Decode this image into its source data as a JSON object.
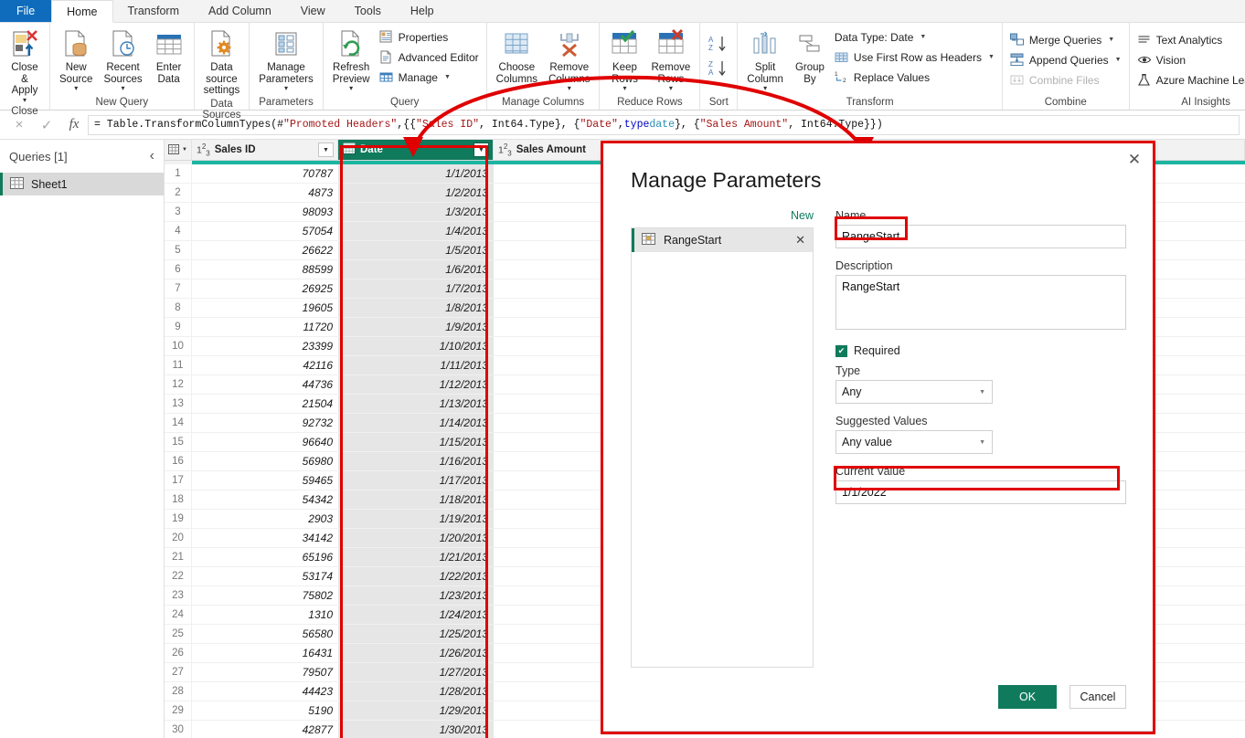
{
  "ribbon": {
    "tabs": [
      {
        "label": "File",
        "kind": "file"
      },
      {
        "label": "Home",
        "kind": "active"
      },
      {
        "label": "Transform",
        "kind": "normal"
      },
      {
        "label": "Add Column",
        "kind": "normal"
      },
      {
        "label": "View",
        "kind": "normal"
      },
      {
        "label": "Tools",
        "kind": "normal"
      },
      {
        "label": "Help",
        "kind": "normal"
      }
    ],
    "groups": {
      "close": {
        "title": "Close",
        "close_apply": "Close &\nApply"
      },
      "new_query": {
        "title": "New Query",
        "new_source": "New\nSource",
        "recent_sources": "Recent\nSources",
        "enter_data": "Enter\nData"
      },
      "data_src": {
        "title": "Data Sources",
        "data_source_settings": "Data source\nsettings"
      },
      "parameters": {
        "title": "Parameters",
        "manage_parameters": "Manage\nParameters"
      },
      "query": {
        "title": "Query",
        "refresh_preview": "Refresh\nPreview",
        "properties": "Properties",
        "advanced_editor": "Advanced Editor",
        "manage": "Manage"
      },
      "manage_cols": {
        "title": "Manage Columns",
        "choose_columns": "Choose\nColumns",
        "remove_columns": "Remove\nColumns"
      },
      "reduce_rows": {
        "title": "Reduce Rows",
        "keep_rows": "Keep\nRows",
        "remove_rows": "Remove\nRows"
      },
      "sort": {
        "title": "Sort",
        "asc": "A-Z ascending",
        "desc": "Z-A descending"
      },
      "transform": {
        "title": "Transform",
        "split_column": "Split\nColumn",
        "group_by": "Group\nBy",
        "data_type": "Data Type: Date",
        "use_first_row": "Use First Row as Headers",
        "replace_values": "Replace Values"
      },
      "combine": {
        "title": "Combine",
        "merge_queries": "Merge Queries",
        "append_queries": "Append Queries",
        "combine_files": "Combine Files"
      },
      "ai": {
        "title": "AI Insights",
        "text_analytics": "Text Analytics",
        "vision": "Vision",
        "azure_ml": "Azure Machine Learning"
      }
    }
  },
  "formula_bar": {
    "cancel_icon": "×",
    "accept_icon": "✓",
    "fx_label": "fx",
    "formula_plain": "= Table.TransformColumnTypes(#\"Promoted Headers\",{{\"Sales ID\", Int64.Type}, {\"Date\", type date}, {\"Sales Amount\", Int64.Type}})",
    "tokens": [
      {
        "t": "= Table.TransformColumnTypes(#",
        "c": "plain"
      },
      {
        "t": "\"Promoted Headers\"",
        "c": "str"
      },
      {
        "t": ",{{",
        "c": "plain"
      },
      {
        "t": "\"Sales ID\"",
        "c": "str"
      },
      {
        "t": ", Int64.Type}, {",
        "c": "plain"
      },
      {
        "t": "\"Date\"",
        "c": "str"
      },
      {
        "t": ", ",
        "c": "plain"
      },
      {
        "t": "type",
        "c": "kw"
      },
      {
        "t": " ",
        "c": "plain"
      },
      {
        "t": "date",
        "c": "ty"
      },
      {
        "t": "}, {",
        "c": "plain"
      },
      {
        "t": "\"Sales Amount\"",
        "c": "str"
      },
      {
        "t": ", Int64.Type}})",
        "c": "plain"
      }
    ]
  },
  "queries_pane": {
    "title": "Queries [1]",
    "collapse_icon": "‹",
    "items": [
      {
        "label": "Sheet1",
        "icon": "table-icon"
      }
    ]
  },
  "grid": {
    "columns": [
      {
        "name": "Sales ID",
        "type_icon": "123",
        "selected": false,
        "width": 160
      },
      {
        "name": "Date",
        "type_icon": "calendar",
        "selected": true,
        "width": 170
      },
      {
        "name": "Sales Amount",
        "type_icon": "123",
        "selected": false,
        "width": 130
      }
    ],
    "rows": [
      {
        "n": "1",
        "sales_id": "70787",
        "date": "1/1/2013",
        "amount": ""
      },
      {
        "n": "2",
        "sales_id": "4873",
        "date": "1/2/2013",
        "amount": ""
      },
      {
        "n": "3",
        "sales_id": "98093",
        "date": "1/3/2013",
        "amount": ""
      },
      {
        "n": "4",
        "sales_id": "57054",
        "date": "1/4/2013",
        "amount": ""
      },
      {
        "n": "5",
        "sales_id": "26622",
        "date": "1/5/2013",
        "amount": ""
      },
      {
        "n": "6",
        "sales_id": "88599",
        "date": "1/6/2013",
        "amount": ""
      },
      {
        "n": "7",
        "sales_id": "26925",
        "date": "1/7/2013",
        "amount": ""
      },
      {
        "n": "8",
        "sales_id": "19605",
        "date": "1/8/2013",
        "amount": ""
      },
      {
        "n": "9",
        "sales_id": "11720",
        "date": "1/9/2013",
        "amount": ""
      },
      {
        "n": "10",
        "sales_id": "23399",
        "date": "1/10/2013",
        "amount": ""
      },
      {
        "n": "11",
        "sales_id": "42116",
        "date": "1/11/2013",
        "amount": ""
      },
      {
        "n": "12",
        "sales_id": "44736",
        "date": "1/12/2013",
        "amount": ""
      },
      {
        "n": "13",
        "sales_id": "21504",
        "date": "1/13/2013",
        "amount": ""
      },
      {
        "n": "14",
        "sales_id": "92732",
        "date": "1/14/2013",
        "amount": ""
      },
      {
        "n": "15",
        "sales_id": "96640",
        "date": "1/15/2013",
        "amount": ""
      },
      {
        "n": "16",
        "sales_id": "56980",
        "date": "1/16/2013",
        "amount": ""
      },
      {
        "n": "17",
        "sales_id": "59465",
        "date": "1/17/2013",
        "amount": ""
      },
      {
        "n": "18",
        "sales_id": "54342",
        "date": "1/18/2013",
        "amount": ""
      },
      {
        "n": "19",
        "sales_id": "2903",
        "date": "1/19/2013",
        "amount": ""
      },
      {
        "n": "20",
        "sales_id": "34142",
        "date": "1/20/2013",
        "amount": ""
      },
      {
        "n": "21",
        "sales_id": "65196",
        "date": "1/21/2013",
        "amount": ""
      },
      {
        "n": "22",
        "sales_id": "53174",
        "date": "1/22/2013",
        "amount": ""
      },
      {
        "n": "23",
        "sales_id": "75802",
        "date": "1/23/2013",
        "amount": ""
      },
      {
        "n": "24",
        "sales_id": "1310",
        "date": "1/24/2013",
        "amount": ""
      },
      {
        "n": "25",
        "sales_id": "56580",
        "date": "1/25/2013",
        "amount": ""
      },
      {
        "n": "26",
        "sales_id": "16431",
        "date": "1/26/2013",
        "amount": ""
      },
      {
        "n": "27",
        "sales_id": "79507",
        "date": "1/27/2013",
        "amount": ""
      },
      {
        "n": "28",
        "sales_id": "44423",
        "date": "1/28/2013",
        "amount": ""
      },
      {
        "n": "29",
        "sales_id": "5190",
        "date": "1/29/2013",
        "amount": ""
      },
      {
        "n": "30",
        "sales_id": "42877",
        "date": "1/30/2013",
        "amount": ""
      }
    ]
  },
  "dialog": {
    "title": "Manage Parameters",
    "close_icon": "✕",
    "new_link": "New",
    "param_items": [
      {
        "label": "RangeStart",
        "remove_icon": "✕"
      }
    ],
    "labels": {
      "name": "Name",
      "description": "Description",
      "required": "Required",
      "type": "Type",
      "suggested_values": "Suggested Values",
      "current_value": "Current Value"
    },
    "values": {
      "name": "RangeStart",
      "description": "RangeStart",
      "required_checked": true,
      "check_glyph": "✔",
      "type": "Any",
      "suggested_values": "Any value",
      "current_value": "1/1/2022"
    },
    "buttons": {
      "ok": "OK",
      "cancel": "Cancel"
    }
  },
  "annotations": {
    "highlight_color": "#e00000",
    "accent_green": "#107a5c"
  }
}
